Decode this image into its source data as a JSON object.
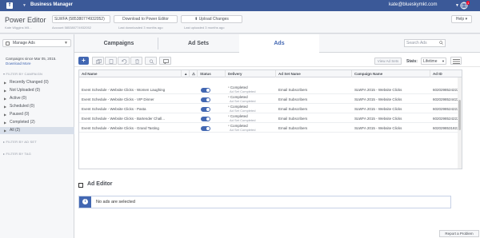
{
  "topbar": {
    "logo": "f",
    "title": "Business Manager",
    "user_email": "kate@blueskymkt.com",
    "notif_count": "1"
  },
  "header": {
    "app_title": "Power Editor",
    "app_sub": "Kate Wiggins Wil...",
    "account_select": "SLWFA (585380774932052)",
    "account_sub": "Account 585380774932052",
    "download_label": "Download to Power Editor",
    "download_sub": "Last downloaded 3 months ago",
    "upload_label": "Upload Changes",
    "upload_sub": "Last uploaded 3 months ago",
    "help_label": "Help"
  },
  "left": {
    "manage_label": "Manage Ads",
    "campaigns_since": "Campaigns since Mar 05, 2015.",
    "download_more": "Download More",
    "filter_campaign_head": "FILTER BY CAMPAIGN",
    "filters": [
      {
        "label": "Recently Changed (0)"
      },
      {
        "label": "Not Uploaded (0)"
      },
      {
        "label": "Active (0)"
      },
      {
        "label": "Scheduled (0)"
      },
      {
        "label": "Paused (0)"
      },
      {
        "label": "Completed (2)"
      },
      {
        "label": "All (2)"
      }
    ],
    "filter_adset_head": "FILTER BY AD SET",
    "filter_tag_head": "FILTER BY TAG"
  },
  "tabs": {
    "campaigns": "Campaigns",
    "adsets": "Ad Sets",
    "ads": "Ads",
    "search_placeholder": "Search Ads"
  },
  "toolbar": {
    "view_adsets": "View Ad Sets",
    "stats_label": "Stats:",
    "stats_value": "Lifetime"
  },
  "table": {
    "headers": {
      "ad_name": "Ad Name",
      "status": "Status",
      "delivery": "Delivery",
      "adset_name": "Ad Set Name",
      "campaign_name": "Campaign Name",
      "ad_id": "Ad ID"
    },
    "rows": [
      {
        "ad_name": "Event Schedule - Website Clicks - Women Laughing",
        "delivery": "Completed",
        "delivery_sub": "Ad Set Completed",
        "adset_name": "Email Subscribers",
        "campaign_name": "SLWFA 2015 - Website Clicks",
        "ad_id": "6020298524222"
      },
      {
        "ad_name": "Event Schedule - Website Clicks - VIP Dinner",
        "delivery": "Completed",
        "delivery_sub": "Ad Set Completed",
        "adset_name": "Email Subscribers",
        "campaign_name": "SLWFA 2015 - Website Clicks",
        "ad_id": "6020298524422"
      },
      {
        "ad_name": "Event Schedule - Website Clicks - Pasta",
        "delivery": "Completed",
        "delivery_sub": "Ad Set Completed",
        "adset_name": "Email Subscribers",
        "campaign_name": "SLWFA 2015 - Website Clicks",
        "ad_id": "6020298524222"
      },
      {
        "ad_name": "Event Schedule - Website Clicks - Bartender Chall...",
        "delivery": "Completed",
        "delivery_sub": "Ad Set Completed",
        "adset_name": "Email Subscribers",
        "campaign_name": "SLWFA 2015 - Website Clicks",
        "ad_id": "6020298524222"
      },
      {
        "ad_name": "Event Schedule - Website Clicks - Grand Tasting",
        "delivery": "Completed",
        "delivery_sub": "Ad Set Completed",
        "adset_name": "Email Subscribers",
        "campaign_name": "SLWFA 2015 - Website Clicks",
        "ad_id": "6020298531822"
      }
    ]
  },
  "editor": {
    "title": "Ad Editor",
    "info_icon": "i",
    "empty_message": "No ads are selected"
  },
  "footer": {
    "report_label": "Report a Problem"
  },
  "colors": {
    "brand": "#3b5998",
    "accent": "#4267b2"
  }
}
